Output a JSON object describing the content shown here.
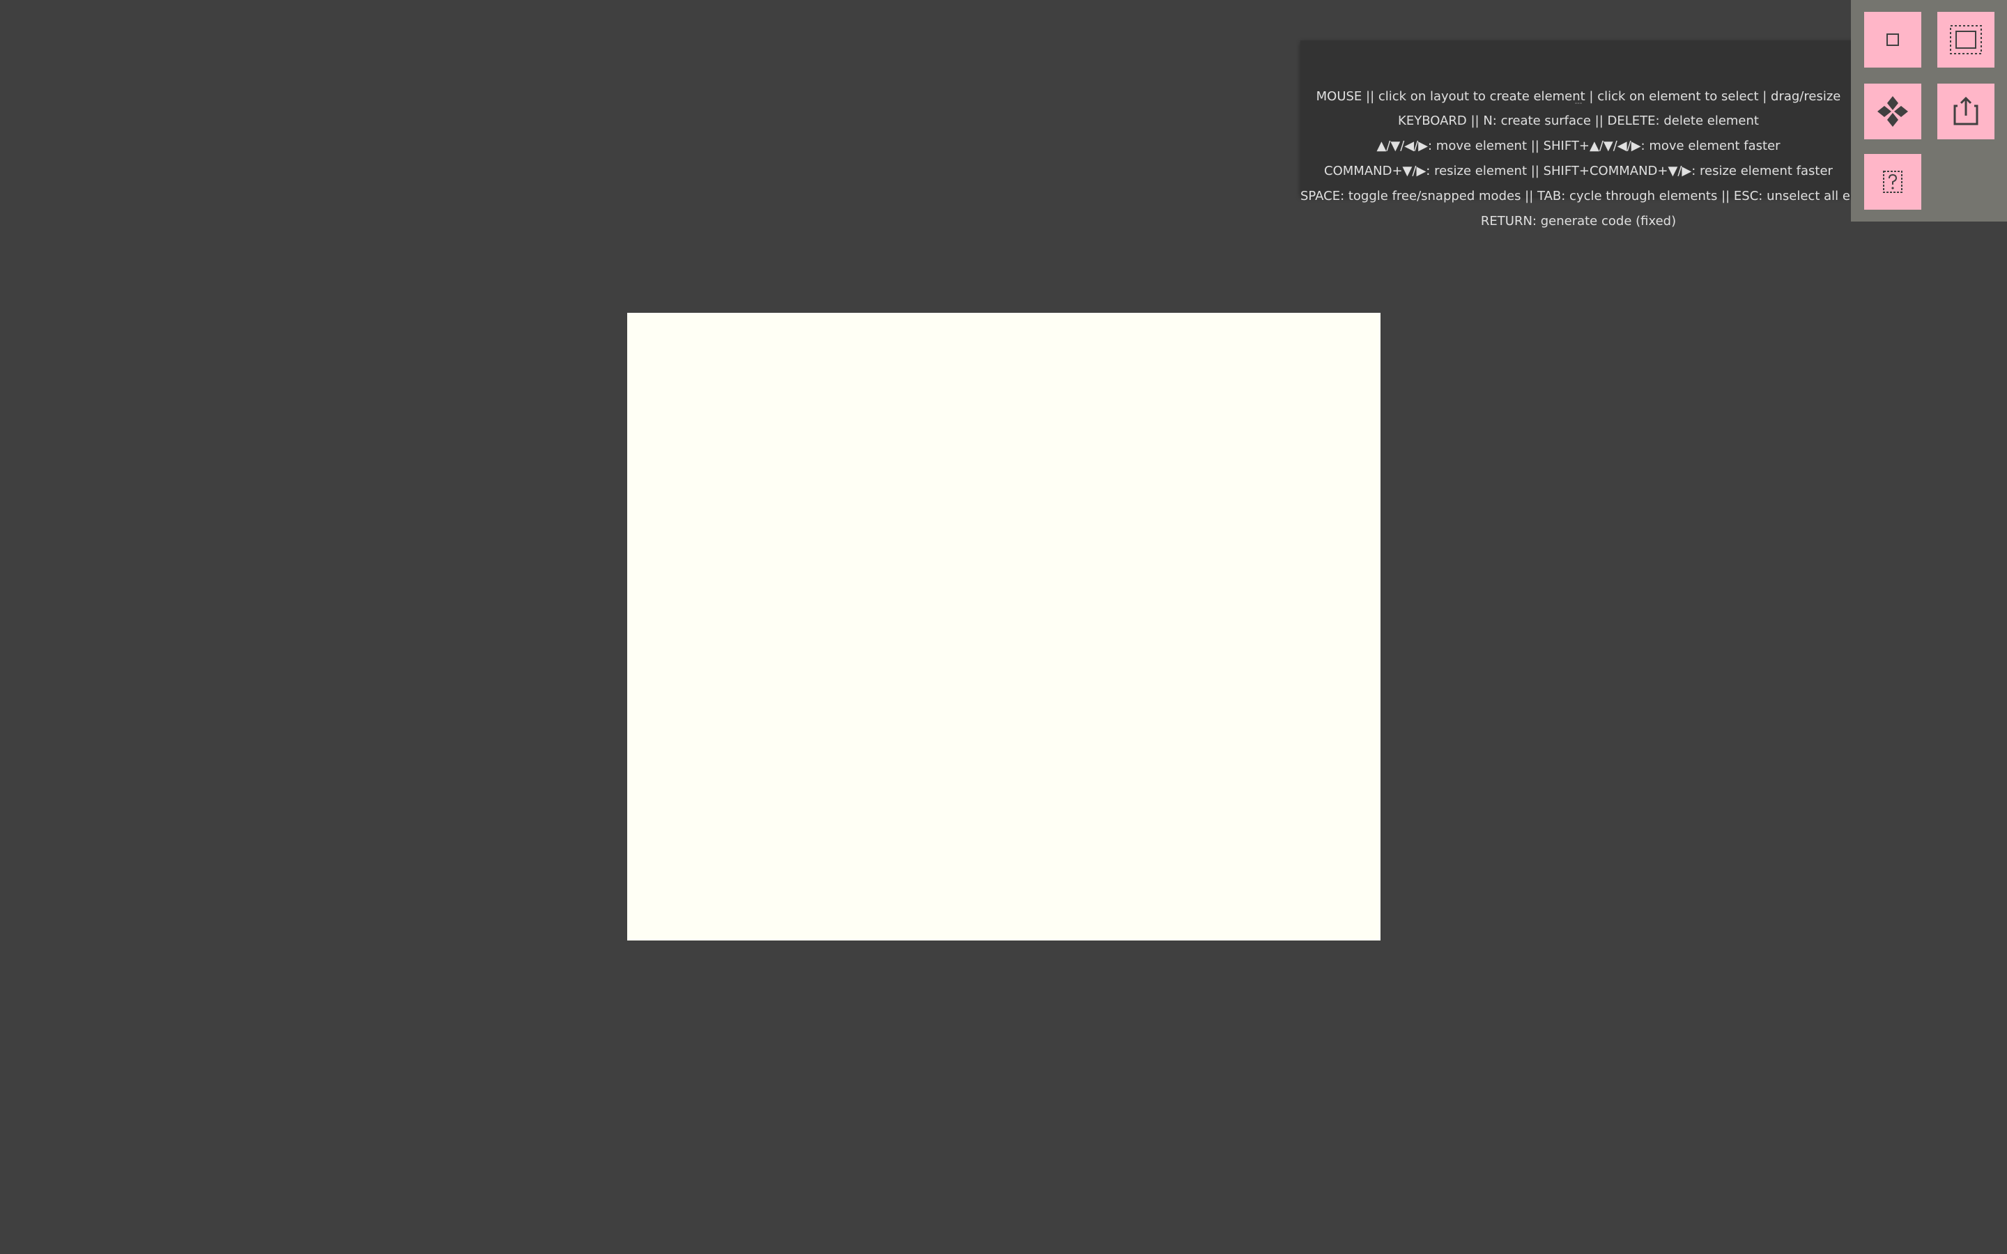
{
  "help": {
    "lines": [
      "MOUSE || click on layout to create element | click on element to select | drag/resize",
      "KEYBOARD || N: create surface || DELETE: delete element",
      "▲/▼/◀/▶: move element || SHIFT+▲/▼/◀/▶: move element faster",
      "COMMAND+▼/▶: resize element || SHIFT+COMMAND+▼/▶: resize element faster",
      "SPACE: toggle free/snapped modes || TAB: cycle through elements || ESC: unselect all elements",
      "RETURN: generate code (fixed)"
    ],
    "separator": "---"
  },
  "toolbar": {
    "buttons": [
      {
        "id": "surface",
        "icon": "square-icon"
      },
      {
        "id": "select",
        "icon": "dashed-frame-icon"
      },
      {
        "id": "move",
        "icon": "four-diamonds-icon"
      },
      {
        "id": "export",
        "icon": "export-icon"
      },
      {
        "id": "help",
        "icon": "question-box-icon"
      }
    ]
  },
  "colors": {
    "background": "#404040",
    "surface": "#FFFFF5",
    "panel": "#333333",
    "toolbar": "#75756F",
    "button": "#FFB6C8",
    "icon": "#404040"
  }
}
